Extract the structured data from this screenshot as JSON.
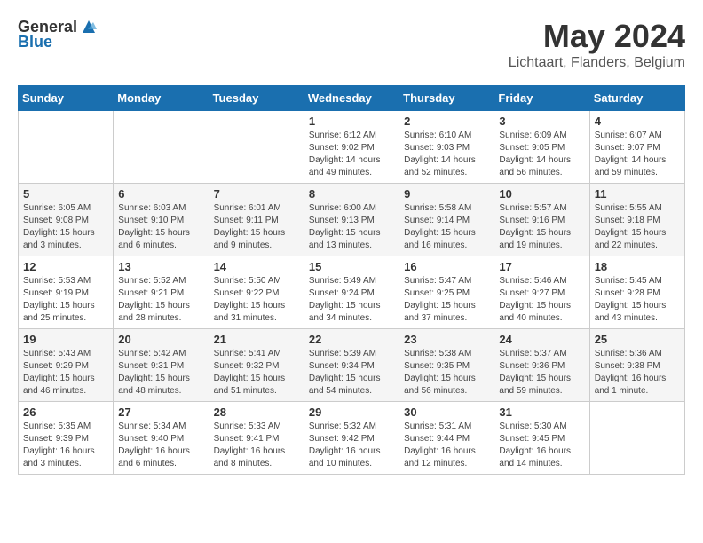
{
  "logo": {
    "text_general": "General",
    "text_blue": "Blue"
  },
  "title": "May 2024",
  "subtitle": "Lichtaart, Flanders, Belgium",
  "days_header": [
    "Sunday",
    "Monday",
    "Tuesday",
    "Wednesday",
    "Thursday",
    "Friday",
    "Saturday"
  ],
  "weeks": [
    [
      {
        "day": "",
        "info": ""
      },
      {
        "day": "",
        "info": ""
      },
      {
        "day": "",
        "info": ""
      },
      {
        "day": "1",
        "info": "Sunrise: 6:12 AM\nSunset: 9:02 PM\nDaylight: 14 hours\nand 49 minutes."
      },
      {
        "day": "2",
        "info": "Sunrise: 6:10 AM\nSunset: 9:03 PM\nDaylight: 14 hours\nand 52 minutes."
      },
      {
        "day": "3",
        "info": "Sunrise: 6:09 AM\nSunset: 9:05 PM\nDaylight: 14 hours\nand 56 minutes."
      },
      {
        "day": "4",
        "info": "Sunrise: 6:07 AM\nSunset: 9:07 PM\nDaylight: 14 hours\nand 59 minutes."
      }
    ],
    [
      {
        "day": "5",
        "info": "Sunrise: 6:05 AM\nSunset: 9:08 PM\nDaylight: 15 hours\nand 3 minutes."
      },
      {
        "day": "6",
        "info": "Sunrise: 6:03 AM\nSunset: 9:10 PM\nDaylight: 15 hours\nand 6 minutes."
      },
      {
        "day": "7",
        "info": "Sunrise: 6:01 AM\nSunset: 9:11 PM\nDaylight: 15 hours\nand 9 minutes."
      },
      {
        "day": "8",
        "info": "Sunrise: 6:00 AM\nSunset: 9:13 PM\nDaylight: 15 hours\nand 13 minutes."
      },
      {
        "day": "9",
        "info": "Sunrise: 5:58 AM\nSunset: 9:14 PM\nDaylight: 15 hours\nand 16 minutes."
      },
      {
        "day": "10",
        "info": "Sunrise: 5:57 AM\nSunset: 9:16 PM\nDaylight: 15 hours\nand 19 minutes."
      },
      {
        "day": "11",
        "info": "Sunrise: 5:55 AM\nSunset: 9:18 PM\nDaylight: 15 hours\nand 22 minutes."
      }
    ],
    [
      {
        "day": "12",
        "info": "Sunrise: 5:53 AM\nSunset: 9:19 PM\nDaylight: 15 hours\nand 25 minutes."
      },
      {
        "day": "13",
        "info": "Sunrise: 5:52 AM\nSunset: 9:21 PM\nDaylight: 15 hours\nand 28 minutes."
      },
      {
        "day": "14",
        "info": "Sunrise: 5:50 AM\nSunset: 9:22 PM\nDaylight: 15 hours\nand 31 minutes."
      },
      {
        "day": "15",
        "info": "Sunrise: 5:49 AM\nSunset: 9:24 PM\nDaylight: 15 hours\nand 34 minutes."
      },
      {
        "day": "16",
        "info": "Sunrise: 5:47 AM\nSunset: 9:25 PM\nDaylight: 15 hours\nand 37 minutes."
      },
      {
        "day": "17",
        "info": "Sunrise: 5:46 AM\nSunset: 9:27 PM\nDaylight: 15 hours\nand 40 minutes."
      },
      {
        "day": "18",
        "info": "Sunrise: 5:45 AM\nSunset: 9:28 PM\nDaylight: 15 hours\nand 43 minutes."
      }
    ],
    [
      {
        "day": "19",
        "info": "Sunrise: 5:43 AM\nSunset: 9:29 PM\nDaylight: 15 hours\nand 46 minutes."
      },
      {
        "day": "20",
        "info": "Sunrise: 5:42 AM\nSunset: 9:31 PM\nDaylight: 15 hours\nand 48 minutes."
      },
      {
        "day": "21",
        "info": "Sunrise: 5:41 AM\nSunset: 9:32 PM\nDaylight: 15 hours\nand 51 minutes."
      },
      {
        "day": "22",
        "info": "Sunrise: 5:39 AM\nSunset: 9:34 PM\nDaylight: 15 hours\nand 54 minutes."
      },
      {
        "day": "23",
        "info": "Sunrise: 5:38 AM\nSunset: 9:35 PM\nDaylight: 15 hours\nand 56 minutes."
      },
      {
        "day": "24",
        "info": "Sunrise: 5:37 AM\nSunset: 9:36 PM\nDaylight: 15 hours\nand 59 minutes."
      },
      {
        "day": "25",
        "info": "Sunrise: 5:36 AM\nSunset: 9:38 PM\nDaylight: 16 hours\nand 1 minute."
      }
    ],
    [
      {
        "day": "26",
        "info": "Sunrise: 5:35 AM\nSunset: 9:39 PM\nDaylight: 16 hours\nand 3 minutes."
      },
      {
        "day": "27",
        "info": "Sunrise: 5:34 AM\nSunset: 9:40 PM\nDaylight: 16 hours\nand 6 minutes."
      },
      {
        "day": "28",
        "info": "Sunrise: 5:33 AM\nSunset: 9:41 PM\nDaylight: 16 hours\nand 8 minutes."
      },
      {
        "day": "29",
        "info": "Sunrise: 5:32 AM\nSunset: 9:42 PM\nDaylight: 16 hours\nand 10 minutes."
      },
      {
        "day": "30",
        "info": "Sunrise: 5:31 AM\nSunset: 9:44 PM\nDaylight: 16 hours\nand 12 minutes."
      },
      {
        "day": "31",
        "info": "Sunrise: 5:30 AM\nSunset: 9:45 PM\nDaylight: 16 hours\nand 14 minutes."
      },
      {
        "day": "",
        "info": ""
      }
    ]
  ]
}
